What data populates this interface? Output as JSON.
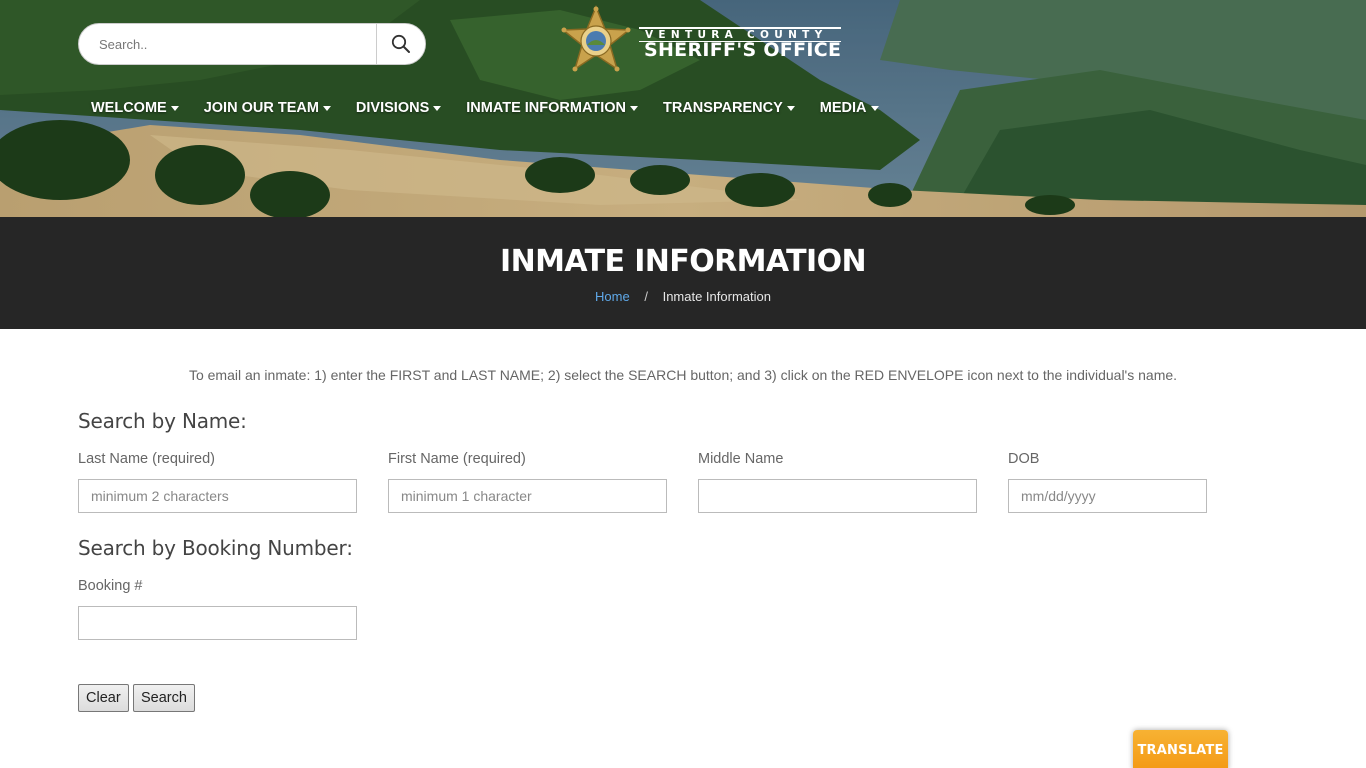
{
  "header": {
    "search": {
      "placeholder": "Search..",
      "button_icon": "search-icon"
    },
    "logo": {
      "line1": "VENTURA COUNTY",
      "line2": "SHERIFF'S OFFICE",
      "badge_icon": "sheriff-star-badge"
    },
    "nav": [
      {
        "label": "WELCOME",
        "icon": "caret-down-icon"
      },
      {
        "label": "JOIN OUR TEAM",
        "icon": "caret-down-icon"
      },
      {
        "label": "DIVISIONS",
        "icon": "caret-down-icon"
      },
      {
        "label": "INMATE INFORMATION",
        "icon": "caret-down-icon"
      },
      {
        "label": "TRANSPARENCY",
        "icon": "caret-down-icon"
      },
      {
        "label": "MEDIA",
        "icon": "caret-down-icon"
      }
    ]
  },
  "title_band": {
    "title": "INMATE INFORMATION",
    "breadcrumb": {
      "home": "Home",
      "separator": "/",
      "current": "Inmate Information"
    }
  },
  "main": {
    "instructions": "To email an inmate: 1) enter the FIRST and LAST NAME; 2) select the SEARCH button; and 3) click on the RED ENVELOPE icon next to the individual's name.",
    "name_search": {
      "heading": "Search by Name:",
      "fields": [
        {
          "label": "Last Name (required)",
          "placeholder": "minimum 2 characters",
          "value": ""
        },
        {
          "label": "First Name (required)",
          "placeholder": "minimum 1 character",
          "value": ""
        },
        {
          "label": "Middle Name",
          "placeholder": "",
          "value": ""
        },
        {
          "label": "DOB",
          "placeholder": "mm/dd/yyyy",
          "value": ""
        }
      ]
    },
    "booking_search": {
      "heading": "Search by Booking Number:",
      "field": {
        "label": "Booking #",
        "placeholder": "",
        "value": ""
      }
    },
    "buttons": {
      "clear": "Clear",
      "search": "Search"
    }
  },
  "translate_widget": {
    "label": "TRANSLATE"
  },
  "colors": {
    "title_band_bg": "#262626",
    "breadcrumb_link": "#5fa8e8",
    "translate_bg": "#f5a623"
  }
}
